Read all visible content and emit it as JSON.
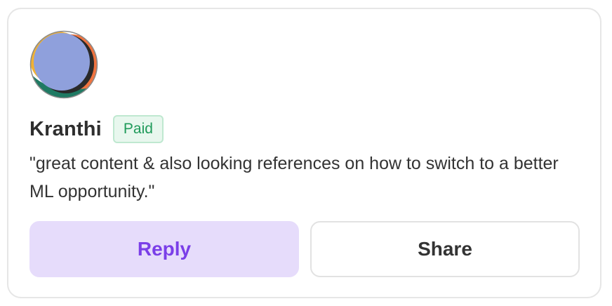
{
  "comment_card": {
    "author": "Kranthi",
    "badge": "Paid",
    "text": "\"great content & also looking references on how to switch to a better ML opportunity.\"",
    "avatar": "abstract-avatar"
  },
  "actions": {
    "reply_label": "Reply",
    "share_label": "Share"
  },
  "colors": {
    "badge_text": "#1f9a5a",
    "badge_bg": "#e8f7ee",
    "reply_text": "#7a3ee8",
    "reply_bg": "#e6dcfb",
    "card_border": "#e6e6e6"
  }
}
